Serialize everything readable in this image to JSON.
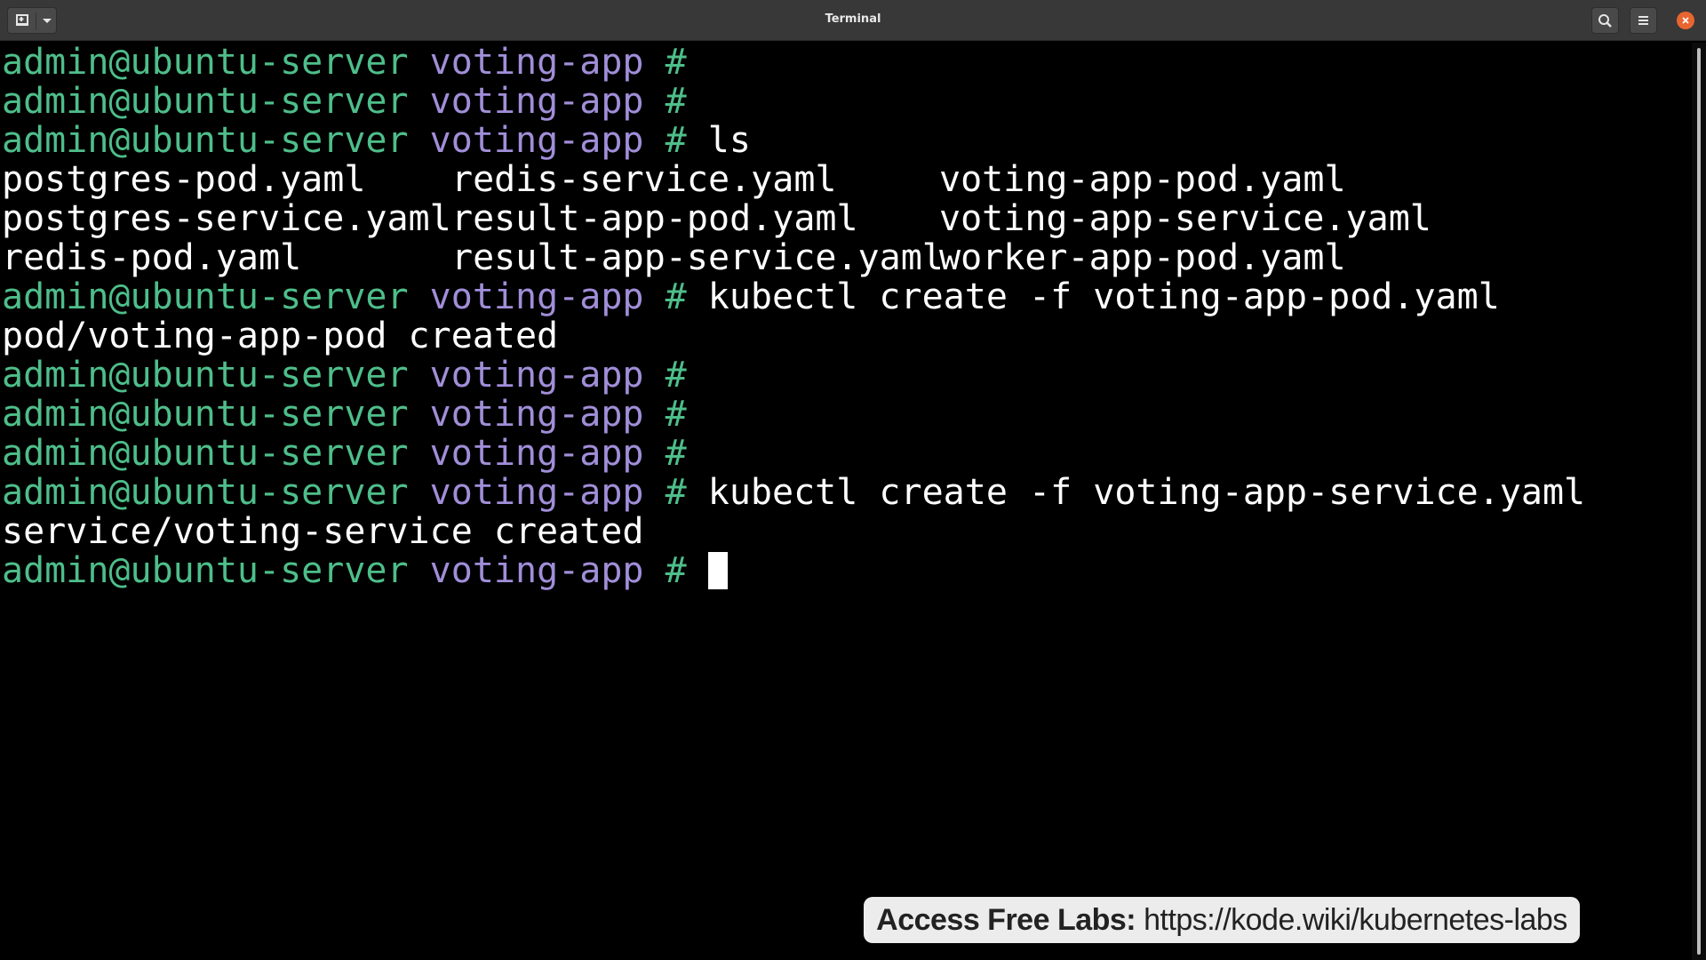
{
  "window": {
    "title": "Terminal"
  },
  "colors": {
    "prompt_user_host": "#4ebe8a",
    "prompt_path": "#a18ed9",
    "text": "#ffffff",
    "background": "#000000",
    "close_button": "#e9652f"
  },
  "icons": {
    "new_tab": "new-tab-icon",
    "dropdown": "chevron-down-icon",
    "search": "search-icon",
    "menu": "hamburger-menu-icon",
    "close": "close-icon"
  },
  "prompt": {
    "user_host": "admin@ubuntu-server",
    "path": "voting-app",
    "symbol": "#"
  },
  "lines": [
    {
      "type": "prompt",
      "command": ""
    },
    {
      "type": "prompt",
      "command": ""
    },
    {
      "type": "prompt",
      "command": "ls"
    },
    {
      "type": "columns",
      "cells": [
        "postgres-pod.yaml",
        "redis-service.yaml",
        "voting-app-pod.yaml"
      ]
    },
    {
      "type": "columns",
      "cells": [
        "postgres-service.yaml",
        "result-app-pod.yaml",
        "voting-app-service.yaml"
      ]
    },
    {
      "type": "columns",
      "cells": [
        "redis-pod.yaml",
        "result-app-service.yaml",
        "worker-app-pod.yaml"
      ]
    },
    {
      "type": "prompt",
      "command": "kubectl create -f voting-app-pod.yaml"
    },
    {
      "type": "output",
      "text": "pod/voting-app-pod created"
    },
    {
      "type": "prompt",
      "command": ""
    },
    {
      "type": "prompt",
      "command": ""
    },
    {
      "type": "prompt",
      "command": ""
    },
    {
      "type": "prompt",
      "command": "kubectl create -f voting-app-service.yaml"
    },
    {
      "type": "output",
      "text": "service/voting-service created"
    },
    {
      "type": "prompt",
      "command": "",
      "cursor": true
    }
  ],
  "banner": {
    "label": "Access Free Labs:",
    "url": "https://kode.wiki/kubernetes-labs"
  }
}
